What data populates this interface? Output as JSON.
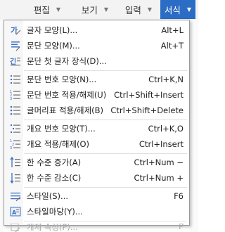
{
  "menubar": {
    "items": [
      {
        "label": "편집"
      },
      {
        "label": "보기"
      },
      {
        "label": "입력"
      },
      {
        "label": "서식"
      }
    ]
  },
  "menu": {
    "items": [
      {
        "label": "글자 모양(L)...",
        "shortcut": "Alt+L",
        "icon": "char-shape-icon"
      },
      {
        "label": "문단 모양(M)...",
        "shortcut": "Alt+T",
        "icon": "para-shape-icon"
      },
      {
        "label": "문단 첫 글자 장식(D)...",
        "shortcut": "",
        "icon": "drop-cap-icon"
      },
      {
        "label": "문단 번호 모양(N)...",
        "shortcut": "Ctrl+K,N",
        "icon": "para-number-shape-icon"
      },
      {
        "label": "문단 번호 적용/해제(U)",
        "shortcut": "Ctrl+Shift+Insert",
        "icon": "para-number-toggle-icon"
      },
      {
        "label": "글머리표 적용/해제(B)",
        "shortcut": "Ctrl+Shift+Delete",
        "icon": "bullet-toggle-icon"
      },
      {
        "label": "개요 번호 모양(T)...",
        "shortcut": "Ctrl+K,O",
        "icon": "outline-number-shape-icon"
      },
      {
        "label": "개요 적용/해제(O)",
        "shortcut": "Ctrl+Insert",
        "icon": "outline-toggle-icon"
      },
      {
        "label": "한 수준 증가(A)",
        "shortcut": "Ctrl+Num −",
        "icon": "level-increase-icon"
      },
      {
        "label": "한 수준 감소(C)",
        "shortcut": "Ctrl+Num +",
        "icon": "level-decrease-icon"
      },
      {
        "label": "스타일(S)...",
        "shortcut": "F6",
        "icon": "style-icon"
      },
      {
        "label": "스타일마당(Y)...",
        "shortcut": "",
        "icon": "style-gallery-icon"
      },
      {
        "label": "개체 속성(P)...",
        "shortcut": "P",
        "icon": "object-property-icon",
        "disabled": true
      }
    ]
  },
  "colors": {
    "accent": "#2b6cc4",
    "icon_blue": "#3a6fc4",
    "icon_gray": "#6b6b6b"
  }
}
